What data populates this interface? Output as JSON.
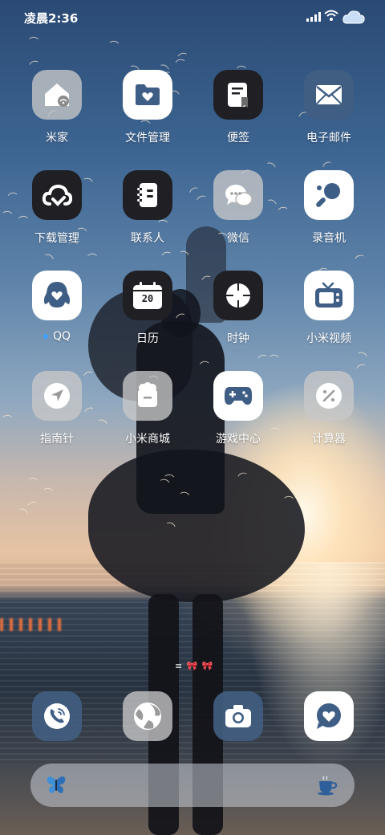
{
  "status_bar": {
    "time": "凌晨2:36"
  },
  "apps": [
    {
      "label": "米家",
      "icon": "mi-home-icon",
      "style": "grey"
    },
    {
      "label": "文件管理",
      "icon": "folder-heart-icon",
      "style": "white"
    },
    {
      "label": "便签",
      "icon": "notes-icon",
      "style": "dark"
    },
    {
      "label": "电子邮件",
      "icon": "mail-icon",
      "style": "navy"
    },
    {
      "label": "下载管理",
      "icon": "download-cloud-icon",
      "style": "dark"
    },
    {
      "label": "联系人",
      "icon": "contacts-book-icon",
      "style": "dark"
    },
    {
      "label": "微信",
      "icon": "chat-bubbles-icon",
      "style": "grey"
    },
    {
      "label": "录音机",
      "icon": "recorder-icon",
      "style": "white"
    },
    {
      "label": "QQ",
      "icon": "qq-penguin-icon",
      "style": "white",
      "has_update_dot": true
    },
    {
      "label": "日历",
      "icon": "calendar-icon",
      "style": "dark",
      "calendar_day": "20"
    },
    {
      "label": "时钟",
      "icon": "clock-icon",
      "style": "dark"
    },
    {
      "label": "小米视频",
      "icon": "tv-icon",
      "style": "white"
    },
    {
      "label": "指南针",
      "icon": "compass-arrow-icon",
      "style": "grey"
    },
    {
      "label": "小米商城",
      "icon": "shop-bag-icon",
      "style": "grey"
    },
    {
      "label": "游戏中心",
      "icon": "gamepad-icon",
      "style": "white"
    },
    {
      "label": "计算器",
      "icon": "calculator-icon",
      "style": "grey"
    }
  ],
  "page_indicator": "≡ 🎀 🎀",
  "dock": [
    {
      "name": "phone",
      "icon": "phone-icon",
      "style": "navy"
    },
    {
      "name": "browser",
      "icon": "browser-globe-icon",
      "style": "grey"
    },
    {
      "name": "camera",
      "icon": "camera-icon",
      "style": "navy"
    },
    {
      "name": "messages",
      "icon": "message-heart-icon",
      "style": "white"
    }
  ],
  "search_bar": {
    "left_icon": "butterfly-icon",
    "right_icon": "coffee-cup-icon"
  },
  "colors": {
    "icon_blue": "#3f5e86",
    "notification_dot": "#3fa0ff"
  }
}
